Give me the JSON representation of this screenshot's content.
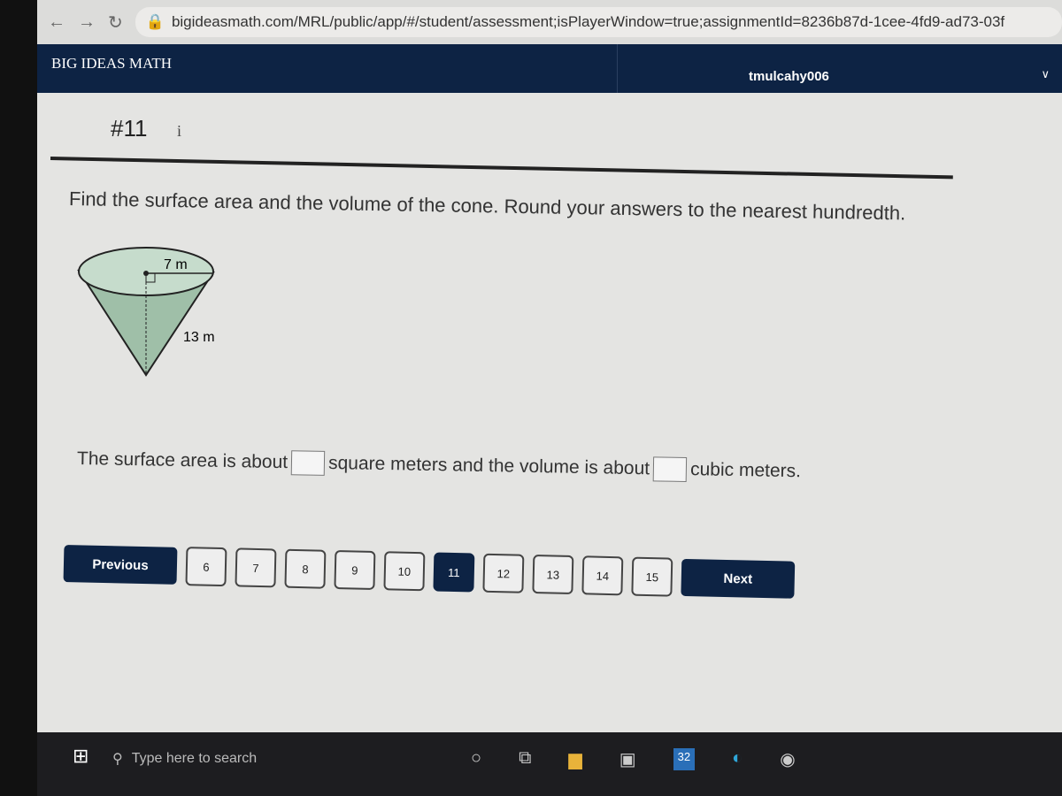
{
  "browser": {
    "url": "bigideasmath.com/MRL/public/app/#/student/assessment;isPlayerWindow=true;assignmentId=8236b87d-1cee-4fd9-ad73-03f"
  },
  "nav": {
    "brand": "BIG IDEAS MATH",
    "user": "tmulcahy006"
  },
  "question": {
    "number": "#11",
    "info": "i",
    "prompt": "Find the surface area and the volume of the cone. Round your answers to the nearest hundredth.",
    "figure": {
      "radius_label": "7 m",
      "slant_label": "13 m"
    },
    "answer": {
      "part1": "The surface area is about",
      "part2": "square meters and the volume is about",
      "part3": "cubic meters.",
      "surface_area_value": "",
      "volume_value": ""
    }
  },
  "pager": {
    "previous": "Previous",
    "next": "Next",
    "pages": [
      "6",
      "7",
      "8",
      "9",
      "10",
      "11",
      "12",
      "13",
      "14",
      "15"
    ],
    "current": "11"
  },
  "taskbar": {
    "search_placeholder": "Type here to search",
    "mail_badge": "32"
  },
  "colors": {
    "navy": "#0d2344"
  }
}
